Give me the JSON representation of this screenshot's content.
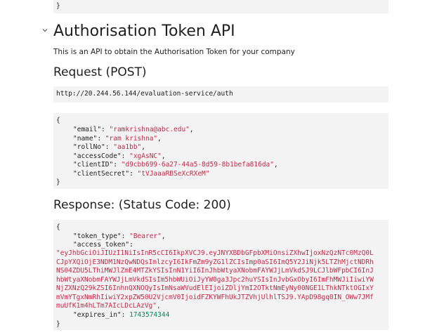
{
  "top_block": {
    "closing_brace": "}"
  },
  "section": {
    "title": "Authorisation Token API",
    "description": "This is an API to obtain the Authorisation Token for your company",
    "chevron_icon": "chevron-down-icon"
  },
  "request": {
    "heading": "Request (POST)",
    "url": "http://20.244.56.144/evaluation-service/auth",
    "body": {
      "open": "{",
      "close": "}",
      "fields": [
        {
          "key": "\"email\"",
          "value": "\"ramkrishna@abc.edu\"",
          "sep": ","
        },
        {
          "key": "\"name\"",
          "value": "\"ram krishna\"",
          "sep": ","
        },
        {
          "key": "\"rollNo\"",
          "value": "\"aa1bb\"",
          "sep": ","
        },
        {
          "key": "\"accessCode\"",
          "value": "\"xgAsNC\"",
          "sep": ","
        },
        {
          "key": "\"clientID\"",
          "value": "\"d9cbb699-6a27-44a5-8d59-8b1befa816da\"",
          "sep": ","
        },
        {
          "key": "\"clientSecret\"",
          "value": "\"tVJaaaRBSeXcRXeM\"",
          "sep": ""
        }
      ]
    }
  },
  "response": {
    "heading": "Response: (Status Code: 200)",
    "body": {
      "open": "{",
      "close": "}",
      "token_type_key": "\"token_type\"",
      "token_type_value": "\"Bearer\"",
      "access_token_key": "\"access_token\"",
      "access_token_lines": [
        "\"eyJhbGciOiJIUzI1NiIsInR5cCI6IkpXVCJ9.eyJNYXBDbGFpbXMiOnsiZXhwIjoxNzQzNTc0MzQ0L",
        "CJpYXQiOjE3NDM1NzQwNDQsImlzcyI6IkFmZm9yZG1lZCIsImp0aSI6ImQ5Y2JiNjk5LTZhMjctNDRh",
        "NS04ZDU5LThiMWJlZmE4MTZkYSIsInN1YiI6InJhbWtyaXNobmFAYWJjLmVkdSJ9LCJlbWFpbCI6InJ",
        "hbWtyaXNobmFAYWJjLmVkdSIsIm5hbWUiOiJyYW0ga3Jpc2huYSIsInJvbGxObyI6ImFhMWJiIiwiYW",
        "NjZXNzQ29kZSI6InhnQXNOQyIsImNsaWVudElEIjoiZDljYmI2OTktNmEyNy00NGE1LThkNTktOGIxY",
        "mVmYTgxNmRhIiwiY2xpZW50U2VjcmV0IjoidFZKYWFhUkJTZVhjUlhlTSJ9.YApD98gq0IN_OWw7JMf",
        "muUfK1m4hLTm7AIcLDcLAzVg\","
      ],
      "expires_in_key": "\"expires_in\"",
      "expires_in_value": "1743574344"
    }
  }
}
